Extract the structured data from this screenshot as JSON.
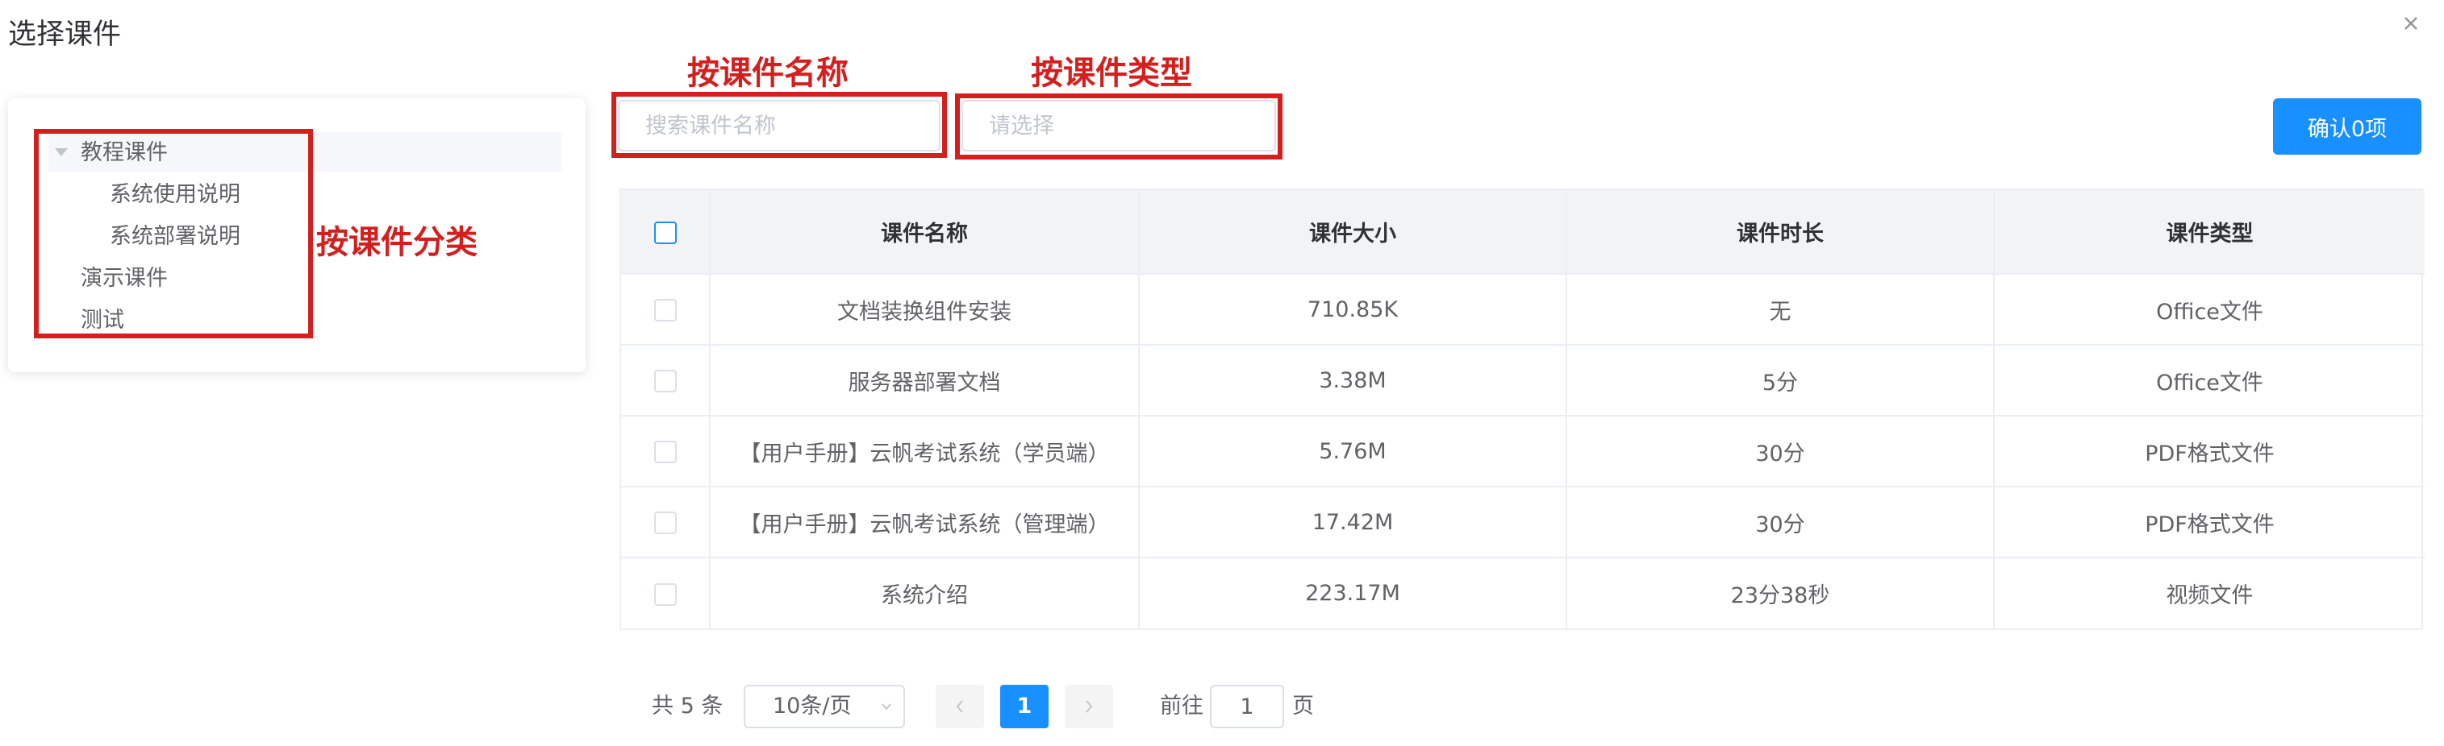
{
  "dialog": {
    "title": "选择课件",
    "close_icon": "close-icon"
  },
  "tree": {
    "nodes": [
      {
        "label": "教程课件",
        "expanded": true
      },
      {
        "label": "系统使用说明"
      },
      {
        "label": "系统部署说明"
      },
      {
        "label": "演示课件"
      },
      {
        "label": "测试"
      }
    ]
  },
  "annotations": {
    "by_category": "按课件分类",
    "by_name": "按课件名称",
    "by_type": "按课件类型",
    "color": "#d3201f"
  },
  "filters": {
    "name_placeholder": "搜索课件名称",
    "type_placeholder": "请选择"
  },
  "confirm_label": "确认0项",
  "table": {
    "headers": [
      "课件名称",
      "课件大小",
      "课件时长",
      "课件类型"
    ],
    "rows": [
      {
        "name": "文档装换组件安装",
        "size": "710.85K",
        "duration": "无",
        "type": "Office文件"
      },
      {
        "name": "服务器部署文档",
        "size": "3.38M",
        "duration": "5分",
        "type": "Office文件"
      },
      {
        "name": "【用户手册】云帆考试系统（学员端）",
        "size": "5.76M",
        "duration": "30分",
        "type": "PDF格式文件"
      },
      {
        "name": "【用户手册】云帆考试系统（管理端）",
        "size": "17.42M",
        "duration": "30分",
        "type": "PDF格式文件"
      },
      {
        "name": "系统介绍",
        "size": "223.17M",
        "duration": "23分38秒",
        "type": "视频文件"
      }
    ]
  },
  "pagination": {
    "total_text": "共 5 条",
    "page_size": "10条/页",
    "current_page": "1",
    "goto_label": "前往",
    "goto_value": "1",
    "page_suffix": "页"
  },
  "colors": {
    "primary": "#1890ff",
    "annotation_red": "#d3201f",
    "header_bg": "#f2f3f5"
  }
}
